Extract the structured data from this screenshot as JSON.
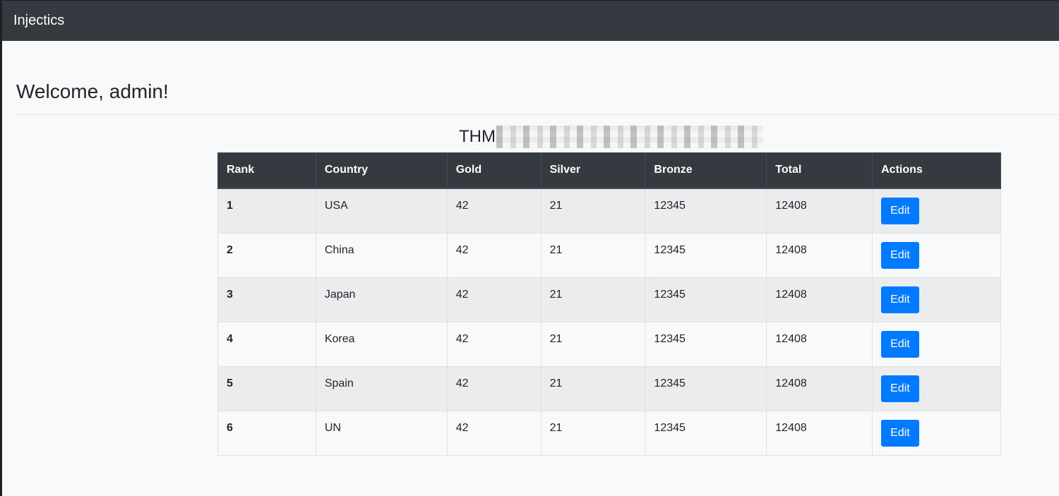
{
  "navbar": {
    "brand": "Injectics"
  },
  "page": {
    "welcome": "Welcome, admin!",
    "flag_prefix": "THM"
  },
  "table": {
    "headers": [
      "Rank",
      "Country",
      "Gold",
      "Silver",
      "Bronze",
      "Total",
      "Actions"
    ],
    "rows": [
      {
        "rank": "1",
        "country": "USA",
        "gold": "42",
        "silver": "21",
        "bronze": "12345",
        "total": "12408",
        "action": "Edit"
      },
      {
        "rank": "2",
        "country": "China",
        "gold": "42",
        "silver": "21",
        "bronze": "12345",
        "total": "12408",
        "action": "Edit"
      },
      {
        "rank": "3",
        "country": "Japan",
        "gold": "42",
        "silver": "21",
        "bronze": "12345",
        "total": "12408",
        "action": "Edit"
      },
      {
        "rank": "4",
        "country": "Korea",
        "gold": "42",
        "silver": "21",
        "bronze": "12345",
        "total": "12408",
        "action": "Edit"
      },
      {
        "rank": "5",
        "country": "Spain",
        "gold": "42",
        "silver": "21",
        "bronze": "12345",
        "total": "12408",
        "action": "Edit"
      },
      {
        "rank": "6",
        "country": "UN",
        "gold": "42",
        "silver": "21",
        "bronze": "12345",
        "total": "12408",
        "action": "Edit"
      }
    ]
  },
  "colors": {
    "navbar_bg": "#343a40",
    "button_primary": "#007bff",
    "page_bg": "#f8f9fa"
  }
}
